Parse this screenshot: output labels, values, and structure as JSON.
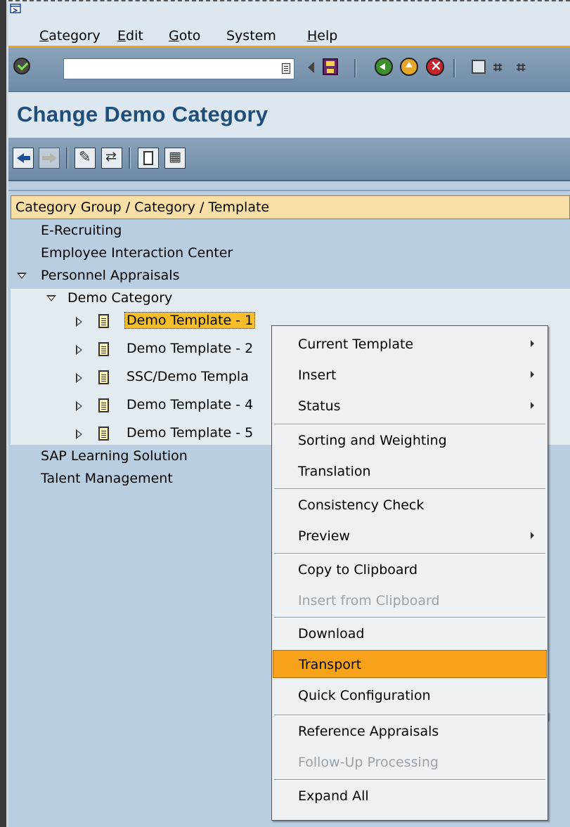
{
  "menubar": {
    "items": [
      {
        "label": "Category",
        "mnemonic": "C"
      },
      {
        "label": "Edit",
        "mnemonic": "E"
      },
      {
        "label": "Goto",
        "mnemonic": "G"
      },
      {
        "label": "System",
        "mnemonic": ""
      },
      {
        "label": "Help",
        "mnemonic": "H"
      }
    ]
  },
  "toolbar": {
    "command_value": "",
    "icons": [
      "enter-icon",
      "command-history-icon",
      "back-triangle-icon",
      "save-icon",
      "back-icon",
      "exit-icon",
      "cancel-icon",
      "print-icon",
      "find-icon",
      "find-next-icon"
    ]
  },
  "title": "Change Demo Category",
  "app_toolbar": {
    "icons": [
      "previous-icon",
      "next-icon",
      "display-change-icon",
      "other-object-icon",
      "create-icon",
      "structure-icon"
    ]
  },
  "tree": {
    "header": "Category Group / Category / Template",
    "nodes": {
      "e_recruiting": "E-Recruiting",
      "eic": "Employee Interaction Center",
      "personnel_appraisals": "Personnel Appraisals",
      "demo_category": "Demo Category",
      "t1": "Demo Template - 1",
      "t2": "Demo Template - 2",
      "t3": "SSC/Demo Templa",
      "t4": "Demo Template - 4",
      "t5": "Demo Template - 5",
      "sap_learning": "SAP Learning Solution",
      "talent": "Talent Management"
    }
  },
  "context_menu": {
    "current_template": "Current Template",
    "insert": "Insert",
    "status": "Status",
    "sorting": "Sorting and Weighting",
    "translation": "Translation",
    "consistency": "Consistency Check",
    "preview": "Preview",
    "copy_clipboard": "Copy to Clipboard",
    "insert_clipboard": "Insert from Clipboard",
    "download": "Download",
    "transport": "Transport",
    "quick_config": "Quick Configuration",
    "reference": "Reference Appraisals",
    "follow_up": "Follow-Up Processing",
    "expand_all": "Expand All"
  },
  "colors": {
    "highlight": "#f7a21b",
    "tree_bg": "#b9cfe1",
    "title": "#1f4e79",
    "selected": "#f7be2a"
  }
}
